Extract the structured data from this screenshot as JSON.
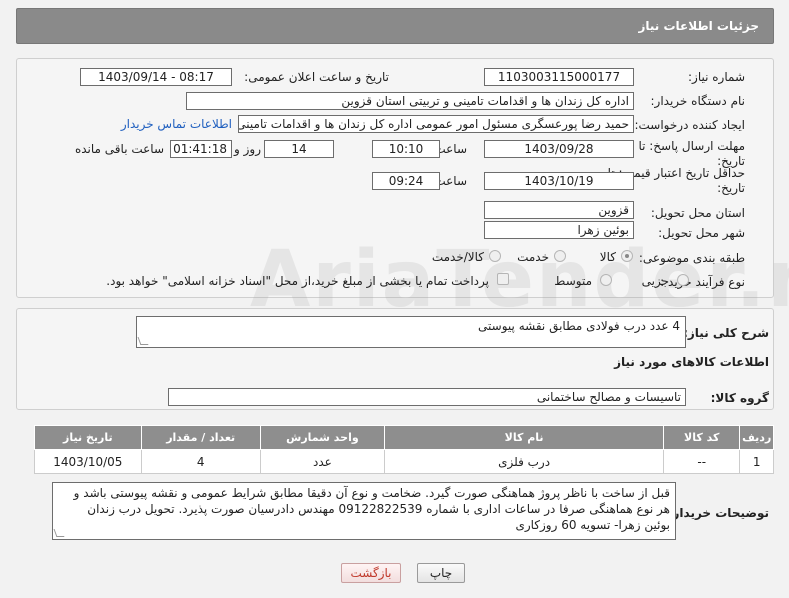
{
  "header": {
    "title": "جزئیات اطلاعات نیاز"
  },
  "form": {
    "need_number_label": "شماره نیاز:",
    "need_number": "1103003115000177",
    "announce_label": "تاریخ و ساعت اعلان عمومی:",
    "announce_value": "1403/09/14 - 08:17",
    "buyer_org_label": "نام دستگاه خریدار:",
    "buyer_org": "اداره کل زندان ها و اقدامات تامینی و تربیتی استان قزوین",
    "requester_label": "ایجاد کننده درخواست:",
    "requester": "حمید رضا  پورعسگری مسئول امور عمومی  اداره کل زندان ها و اقدامات تامینی",
    "contact_link": "اطلاعات تماس خریدار",
    "reply_deadline_label_1": "مهلت ارسال پاسخ: تا",
    "reply_deadline_label_2": "تاریخ:",
    "reply_date": "1403/09/28",
    "time_label": "ساعت",
    "reply_time": "10:10",
    "days_value": "14",
    "days_label": "روز و",
    "remaining_time": "01:41:18",
    "remaining_label": "ساعت باقی مانده",
    "validity_label_1": "حداقل تاریخ اعتبار قیمت: تا",
    "validity_label_2": "تاریخ:",
    "validity_date": "1403/10/19",
    "validity_time_label": "ساعت",
    "validity_time": "09:24",
    "province_label": "استان محل تحویل:",
    "province": "قزوین",
    "city_label": "شهر محل تحویل:",
    "city": "بوئین زهرا",
    "category_label": "طبقه بندی موضوعی:",
    "category_options": [
      "کالا",
      "خدمت",
      "کالا/خدمت"
    ],
    "process_label": "نوع فرآیند خرید :",
    "process_options": [
      "جزیی",
      "متوسط"
    ],
    "treasury_text": "پرداخت تمام یا بخشی از مبلغ خرید،از محل \"اسناد خزانه اسلامی\" خواهد بود."
  },
  "summary": {
    "label": "شرح کلی نیاز:",
    "value": "4 عدد درب فولادی مطابق نقشه پیوستی"
  },
  "goods": {
    "section_title": "اطلاعات کالاهای مورد نیاز",
    "group_label": "گروه کالا:",
    "group_value": "تاسیسات و مصالح ساختمانی",
    "columns": [
      "ردیف",
      "کد کالا",
      "نام کالا",
      "واحد شمارش",
      "تعداد / مقدار",
      "تاریخ نیاز"
    ],
    "rows": [
      [
        "1",
        "--",
        "درب فلزی",
        "عدد",
        "4",
        "1403/10/05"
      ]
    ]
  },
  "buyer_notes": {
    "label": "توضیحات خریدار:",
    "text": "قبل از ساخت با ناظر پروژ هماهنگی صورت گیرد. ضخامت و نوع آن دقیقا مطابق شرایط عمومی و نقشه پیوستی باشد و هر نوع هماهنگی صرفا در ساعات اداری با شماره 09122822539 مهندس دادرسیان صورت پذیرد. تحویل درب زندان بوئین زهرا- تسویه 60 روزکاری"
  },
  "buttons": {
    "print": "چاپ",
    "back": "بازگشت"
  },
  "watermark": "AriaTender.net",
  "colors": {
    "header_bg": "#8a8a8a",
    "link": "#1f5fbf",
    "back_button": "#c0392b"
  }
}
